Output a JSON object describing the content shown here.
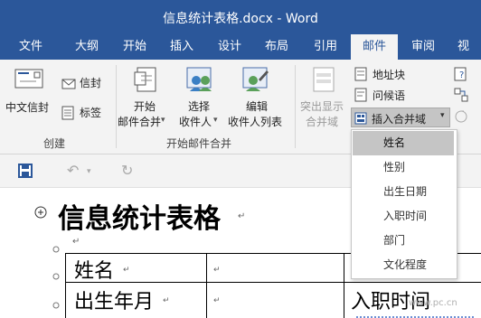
{
  "window": {
    "title": "信息统计表格.docx - Word"
  },
  "tabs": [
    {
      "label": "文件"
    },
    {
      "label": "大纲"
    },
    {
      "label": "开始"
    },
    {
      "label": "插入"
    },
    {
      "label": "设计"
    },
    {
      "label": "布局"
    },
    {
      "label": "引用"
    },
    {
      "label": "邮件"
    },
    {
      "label": "审阅"
    },
    {
      "label": "视"
    }
  ],
  "ribbon": {
    "create": {
      "chinese_envelope": "中文信封",
      "envelope": "信封",
      "labels": "标签",
      "group": "创建"
    },
    "start_merge": {
      "start_line1": "开始",
      "start_line2": "邮件合并",
      "select_line1": "选择",
      "select_line2": "收件人",
      "edit_line1": "编辑",
      "edit_line2": "收件人列表",
      "group": "开始邮件合并"
    },
    "write_insert": {
      "highlight_line1": "突出显示",
      "highlight_line2": "合并域",
      "address_block": "地址块",
      "greeting_line": "问候语",
      "insert_merge_field": "插入合并域"
    }
  },
  "merge_fields": [
    "姓名",
    "性别",
    "出生日期",
    "入职时间",
    "部门",
    "文化程度"
  ],
  "document": {
    "heading": "信息统计表格",
    "table": [
      [
        "姓名",
        ""
      ],
      [
        "出生年月",
        "",
        "入职时间"
      ]
    ],
    "mark": "↵",
    "watermark": "www.pc.cn"
  },
  "colors": {
    "accent": "#2b579a",
    "ribbon": "#f3f3f3"
  }
}
